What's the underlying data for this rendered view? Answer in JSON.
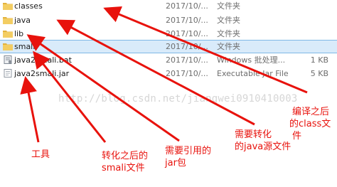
{
  "files": [
    {
      "name": "classes",
      "date": "2017/10/...",
      "type": "文件夹",
      "size": "",
      "icon": "folder-icon"
    },
    {
      "name": "java",
      "date": "2017/10/...",
      "type": "文件夹",
      "size": "",
      "icon": "folder-icon"
    },
    {
      "name": "lib",
      "date": "2017/10/...",
      "type": "文件夹",
      "size": "",
      "icon": "folder-icon"
    },
    {
      "name": "smali",
      "date": "2017/10/...",
      "type": "文件夹",
      "size": "",
      "icon": "folder-icon"
    },
    {
      "name": "java2smali.bat",
      "date": "2017/10/...",
      "type": "Windows 批处理...",
      "size": "1 KB",
      "icon": "batch-file-icon"
    },
    {
      "name": "java2smali.jar",
      "date": "2017/10/...",
      "type": "Executable Jar File",
      "size": "5 KB",
      "icon": "jar-file-icon"
    }
  ],
  "selected_row": 3,
  "watermark": "http://blog.csdn.net/jiangwei0910410003",
  "annotations": {
    "tool": "工具",
    "smali_1": "转化之后的",
    "smali_2": "smali文件",
    "jar_1": "需要引用的",
    "jar_2": "jar包",
    "java_1": "需要转化",
    "java_2": "的java源文件",
    "class_1": "编译之后",
    "class_2": "的class文",
    "class_3": "件"
  },
  "colors": {
    "annotation": "#e8120c",
    "folder": "#f0c24a",
    "selection": "#d9ebfa"
  }
}
